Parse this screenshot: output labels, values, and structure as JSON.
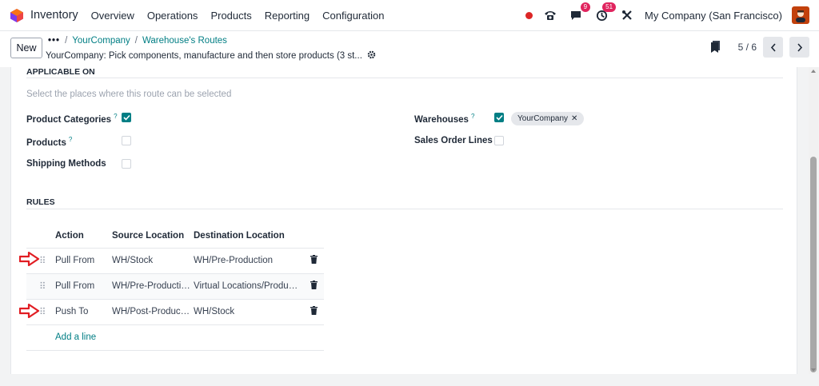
{
  "topbar": {
    "app_name": "Inventory",
    "menu": [
      "Overview",
      "Operations",
      "Products",
      "Reporting",
      "Configuration"
    ],
    "chat_badge": "9",
    "activity_badge": "51",
    "company": "My Company (San Francisco)"
  },
  "control": {
    "new_label": "New",
    "breadcrumb_dots": "•••",
    "breadcrumb": [
      "YourCompany",
      "Warehouse's Routes"
    ],
    "record_title": "YourCompany: Pick components, manufacture and then store products (3 st...",
    "pager": "5 / 6"
  },
  "applicable_on": {
    "heading": "APPLICABLE ON",
    "hint": "Select the places where this route can be selected",
    "product_categories_label": "Product Categories",
    "product_categories_checked": true,
    "products_label": "Products",
    "products_checked": false,
    "shipping_methods_label": "Shipping Methods",
    "shipping_methods_checked": false,
    "warehouses_label": "Warehouses",
    "warehouses_checked": true,
    "warehouse_tag": "YourCompany",
    "sales_order_lines_label": "Sales Order Lines",
    "sales_order_lines_checked": false,
    "help_mark": "?"
  },
  "rules": {
    "heading": "RULES",
    "columns": [
      "Action",
      "Source Location",
      "Destination Location"
    ],
    "rows": [
      {
        "action": "Pull From",
        "source": "WH/Stock",
        "destination": "WH/Pre-Production"
      },
      {
        "action": "Pull From",
        "source": "WH/Pre-Production",
        "destination": "Virtual Locations/Production"
      },
      {
        "action": "Push To",
        "source": "WH/Post-Production",
        "destination": "WH/Stock"
      }
    ],
    "add_line": "Add a line"
  },
  "colors": {
    "accent": "#017e84",
    "badge": "#e0245e",
    "annotation_arrow": "#e11d23"
  }
}
